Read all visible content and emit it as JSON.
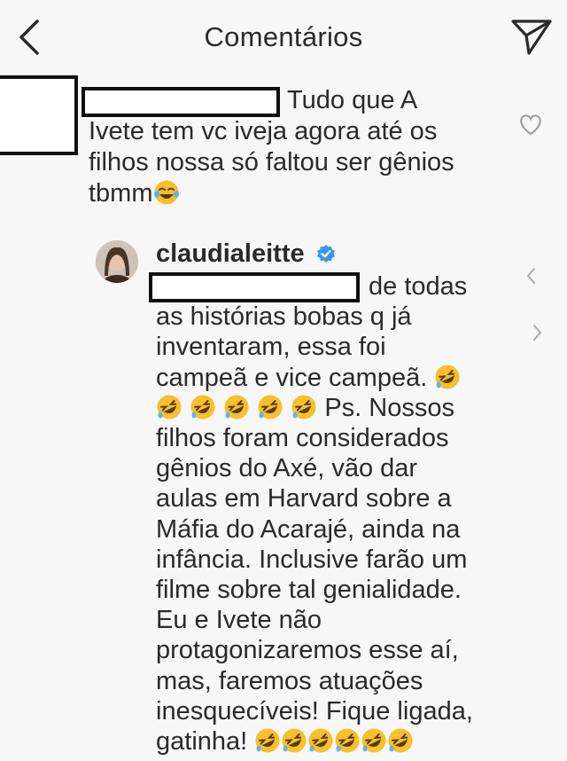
{
  "header": {
    "title": "Comentários",
    "back_icon": "chevron-left-icon",
    "send_icon": "paper-plane-icon"
  },
  "comment": {
    "text": "Tudo que A\nIvete tem vc iveja agora até os\nfilhos nossa só faltou ser gênios\ntbmm",
    "emoji": "😂",
    "like_icon": "heart-icon"
  },
  "reply": {
    "username": "claudialeitte",
    "verified_icon": "verified-badge-icon",
    "line1": "de todas",
    "text_main": "as histórias bobas q já\ninventaram, essa foi\ncampeã e vice campeã.",
    "ps_text": "Ps. Nossos\nfilhos foram considerados\ngênios do Axé, vão dar\naulas em Harvard sobre a\nMáfia do Acarajé, ainda na\ninfância. Inclusive farão um\nfilme sobre tal genialidade.\nEu e Ivete não\nprotagonizaremos esse aí,\nmas, faremos atuações\ninesquecíveis! Fique ligada,\ngatinha!",
    "emoji": "🤣"
  },
  "colors": {
    "background": "#f7f7f7",
    "text": "#2a2a2a",
    "verified": "#3897f0",
    "emoji_face": "#f7c02c"
  }
}
